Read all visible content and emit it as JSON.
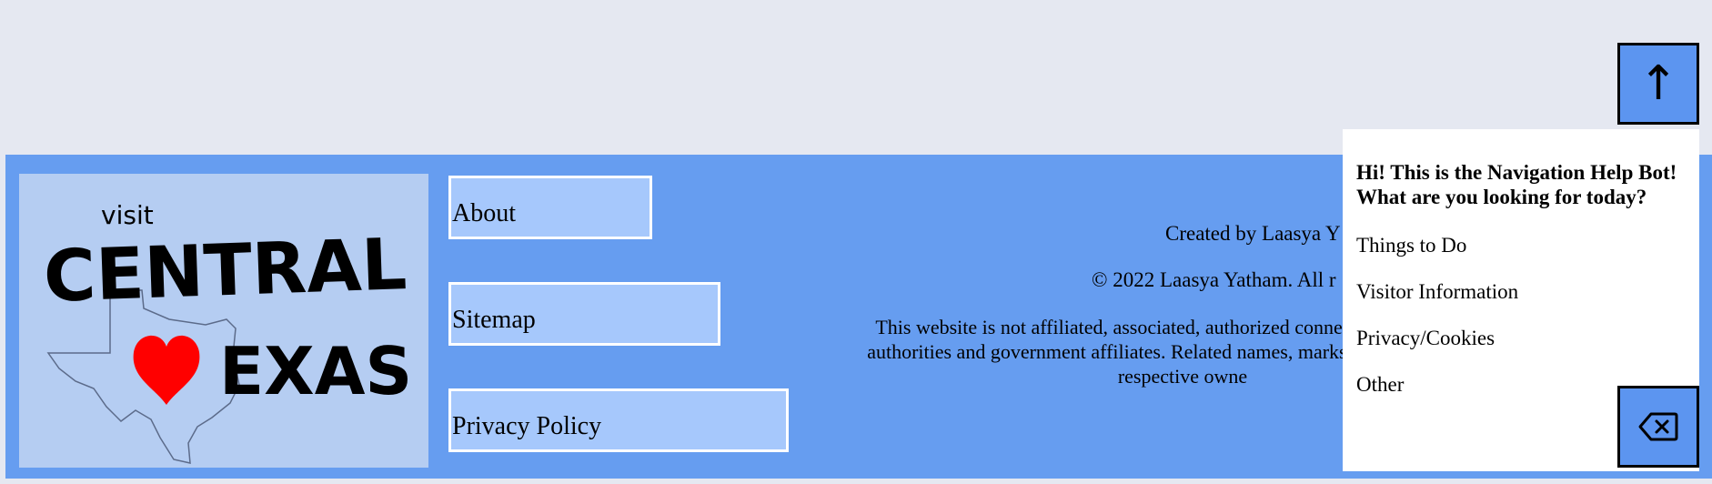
{
  "colors": {
    "page_bg": "#e5e8f1",
    "footer_bg": "#669df0",
    "logo_bg": "#b5cdf2",
    "nav_link_bg": "#a6c8fc",
    "button_bg": "#5c95f0",
    "heart": "#ff0000"
  },
  "logo": {
    "alt_text": "Visit Central Texas",
    "icons": [
      "texas-outline",
      "heart"
    ]
  },
  "nav": {
    "about": "About",
    "sitemap": "Sitemap",
    "privacy_policy": "Privacy Policy"
  },
  "footer": {
    "created_by": "Created by Laasya Y",
    "copyright": "© 2022 Laasya Yatham. All r",
    "disclaimer": "This website is not affiliated, associated, authorized connected with the local authorities and government affiliates. Related names, marks, emblems and ima respective owne"
  },
  "chatbot": {
    "title": "Hi! This is the Navigation Help Bot! What are you looking for today?",
    "options": [
      "Things to Do",
      "Visitor Information",
      "Privacy/Cookies",
      "Other"
    ]
  },
  "buttons": {
    "scroll_top_icon": "up-arrow",
    "scroll_top_symbol": "↑",
    "close_chat_icon": "backspace-icon"
  }
}
